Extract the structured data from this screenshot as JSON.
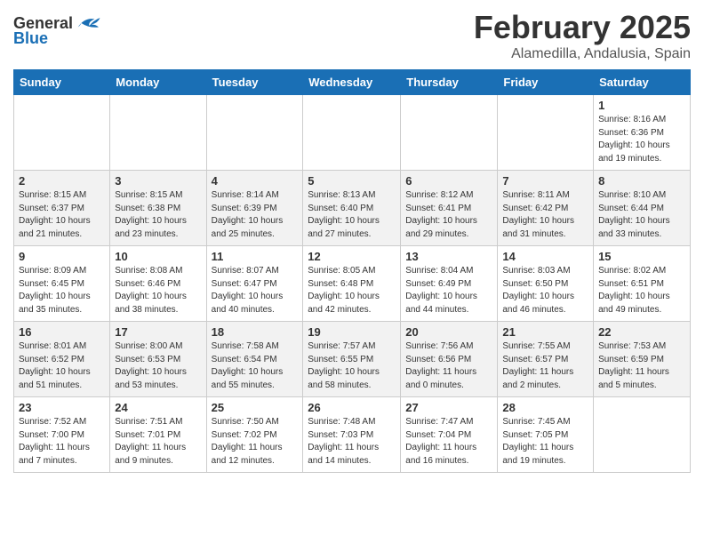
{
  "header": {
    "logo_general": "General",
    "logo_blue": "Blue",
    "month": "February 2025",
    "location": "Alamedilla, Andalusia, Spain"
  },
  "weekdays": [
    "Sunday",
    "Monday",
    "Tuesday",
    "Wednesday",
    "Thursday",
    "Friday",
    "Saturday"
  ],
  "weeks": [
    [
      {
        "day": "",
        "info": ""
      },
      {
        "day": "",
        "info": ""
      },
      {
        "day": "",
        "info": ""
      },
      {
        "day": "",
        "info": ""
      },
      {
        "day": "",
        "info": ""
      },
      {
        "day": "",
        "info": ""
      },
      {
        "day": "1",
        "info": "Sunrise: 8:16 AM\nSunset: 6:36 PM\nDaylight: 10 hours\nand 19 minutes."
      }
    ],
    [
      {
        "day": "2",
        "info": "Sunrise: 8:15 AM\nSunset: 6:37 PM\nDaylight: 10 hours\nand 21 minutes."
      },
      {
        "day": "3",
        "info": "Sunrise: 8:15 AM\nSunset: 6:38 PM\nDaylight: 10 hours\nand 23 minutes."
      },
      {
        "day": "4",
        "info": "Sunrise: 8:14 AM\nSunset: 6:39 PM\nDaylight: 10 hours\nand 25 minutes."
      },
      {
        "day": "5",
        "info": "Sunrise: 8:13 AM\nSunset: 6:40 PM\nDaylight: 10 hours\nand 27 minutes."
      },
      {
        "day": "6",
        "info": "Sunrise: 8:12 AM\nSunset: 6:41 PM\nDaylight: 10 hours\nand 29 minutes."
      },
      {
        "day": "7",
        "info": "Sunrise: 8:11 AM\nSunset: 6:42 PM\nDaylight: 10 hours\nand 31 minutes."
      },
      {
        "day": "8",
        "info": "Sunrise: 8:10 AM\nSunset: 6:44 PM\nDaylight: 10 hours\nand 33 minutes."
      }
    ],
    [
      {
        "day": "9",
        "info": "Sunrise: 8:09 AM\nSunset: 6:45 PM\nDaylight: 10 hours\nand 35 minutes."
      },
      {
        "day": "10",
        "info": "Sunrise: 8:08 AM\nSunset: 6:46 PM\nDaylight: 10 hours\nand 38 minutes."
      },
      {
        "day": "11",
        "info": "Sunrise: 8:07 AM\nSunset: 6:47 PM\nDaylight: 10 hours\nand 40 minutes."
      },
      {
        "day": "12",
        "info": "Sunrise: 8:05 AM\nSunset: 6:48 PM\nDaylight: 10 hours\nand 42 minutes."
      },
      {
        "day": "13",
        "info": "Sunrise: 8:04 AM\nSunset: 6:49 PM\nDaylight: 10 hours\nand 44 minutes."
      },
      {
        "day": "14",
        "info": "Sunrise: 8:03 AM\nSunset: 6:50 PM\nDaylight: 10 hours\nand 46 minutes."
      },
      {
        "day": "15",
        "info": "Sunrise: 8:02 AM\nSunset: 6:51 PM\nDaylight: 10 hours\nand 49 minutes."
      }
    ],
    [
      {
        "day": "16",
        "info": "Sunrise: 8:01 AM\nSunset: 6:52 PM\nDaylight: 10 hours\nand 51 minutes."
      },
      {
        "day": "17",
        "info": "Sunrise: 8:00 AM\nSunset: 6:53 PM\nDaylight: 10 hours\nand 53 minutes."
      },
      {
        "day": "18",
        "info": "Sunrise: 7:58 AM\nSunset: 6:54 PM\nDaylight: 10 hours\nand 55 minutes."
      },
      {
        "day": "19",
        "info": "Sunrise: 7:57 AM\nSunset: 6:55 PM\nDaylight: 10 hours\nand 58 minutes."
      },
      {
        "day": "20",
        "info": "Sunrise: 7:56 AM\nSunset: 6:56 PM\nDaylight: 11 hours\nand 0 minutes."
      },
      {
        "day": "21",
        "info": "Sunrise: 7:55 AM\nSunset: 6:57 PM\nDaylight: 11 hours\nand 2 minutes."
      },
      {
        "day": "22",
        "info": "Sunrise: 7:53 AM\nSunset: 6:59 PM\nDaylight: 11 hours\nand 5 minutes."
      }
    ],
    [
      {
        "day": "23",
        "info": "Sunrise: 7:52 AM\nSunset: 7:00 PM\nDaylight: 11 hours\nand 7 minutes."
      },
      {
        "day": "24",
        "info": "Sunrise: 7:51 AM\nSunset: 7:01 PM\nDaylight: 11 hours\nand 9 minutes."
      },
      {
        "day": "25",
        "info": "Sunrise: 7:50 AM\nSunset: 7:02 PM\nDaylight: 11 hours\nand 12 minutes."
      },
      {
        "day": "26",
        "info": "Sunrise: 7:48 AM\nSunset: 7:03 PM\nDaylight: 11 hours\nand 14 minutes."
      },
      {
        "day": "27",
        "info": "Sunrise: 7:47 AM\nSunset: 7:04 PM\nDaylight: 11 hours\nand 16 minutes."
      },
      {
        "day": "28",
        "info": "Sunrise: 7:45 AM\nSunset: 7:05 PM\nDaylight: 11 hours\nand 19 minutes."
      },
      {
        "day": "",
        "info": ""
      }
    ]
  ]
}
